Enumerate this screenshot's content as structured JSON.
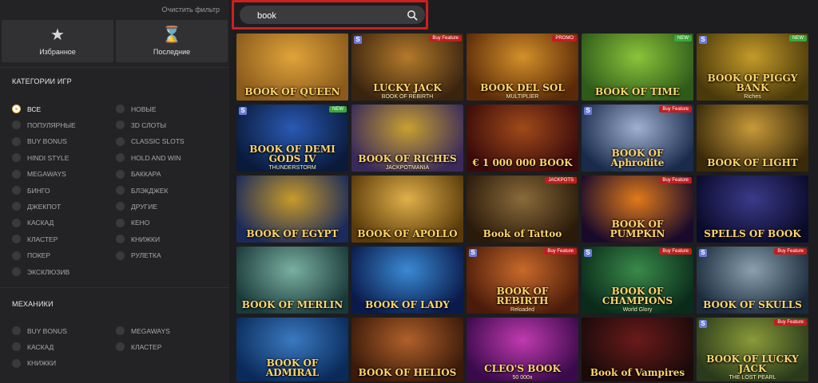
{
  "sidebar": {
    "clear_filter": "Очистить фильтр",
    "favorites_label": "Избранное",
    "recent_label": "Последние",
    "categories_title": "КАТЕГОРИИ ИГР",
    "categories_left": [
      "ВСЕ",
      "ПОПУЛЯРНЫЕ",
      "BUY BONUS",
      "HINDI STYLE",
      "MEGAWAYS",
      "БИНГО",
      "ДЖЕКПОТ",
      "КАСКАД",
      "КЛАСТЕР",
      "ПОКЕР",
      "ЭКСКЛЮЗИВ"
    ],
    "categories_right": [
      "НОВЫЕ",
      "3D СЛОТЫ",
      "CLASSIC SLOTS",
      "HOLD AND WIN",
      "БАККАРА",
      "БЛЭКДЖЕК",
      "ДРУГИЕ",
      "КЕНО",
      "КНИЖКИ",
      "РУЛЕТКА"
    ],
    "mechanics_title": "МЕХАНИКИ",
    "mechanics_left": [
      "BUY BONUS",
      "КАСКАД",
      "КНИЖКИ"
    ],
    "mechanics_right": [
      "MEGAWAYS",
      "КЛАСТЕР"
    ]
  },
  "search": {
    "value": "book"
  },
  "games": [
    {
      "title": "BOOK OF QUEEN",
      "sub": "",
      "bg": "#8a5a1c,#e0a43a",
      "badge": "",
      "prov": false
    },
    {
      "title": "LUCKY JACK",
      "sub": "BOOK OF REBIRTH",
      "bg": "#3a2410,#b47a2a",
      "badge": "Buy Feature",
      "prov": true
    },
    {
      "title": "BOOK DEL SOL",
      "sub": "MULTIPLIER",
      "bg": "#5a2a08,#d4902a",
      "badge": "PROMO",
      "prov": false
    },
    {
      "title": "BOOK OF TIME",
      "sub": "",
      "bg": "#2e5a1a,#8ac43a",
      "badge": "NEW",
      "prov": false
    },
    {
      "title": "BOOK OF PIGGY BANK",
      "sub": "Riches",
      "bg": "#4a3a0a,#c49a2a",
      "badge": "NEW",
      "prov": true
    },
    {
      "title": "BOOK OF DEMI GODS IV",
      "sub": "THUNDERSTORM",
      "bg": "#0a1a3a,#2a5ab4",
      "badge": "NEW",
      "prov": true
    },
    {
      "title": "BOOK OF RICHES",
      "sub": "JACKPOTMANIA",
      "bg": "#3a2a5a,#c8a030",
      "badge": "",
      "prov": false
    },
    {
      "title": "€ 1 000 000 BOOK",
      "sub": "",
      "bg": "#3a0a0a,#a04a1a",
      "badge": "",
      "prov": false
    },
    {
      "title": "BOOK OF Aphrodite",
      "sub": "",
      "bg": "#1a2a4a,#a0b0d0",
      "badge": "Buy Feature",
      "prov": true
    },
    {
      "title": "BOOK OF LIGHT",
      "sub": "",
      "bg": "#3a2a0a,#c89a3a",
      "badge": "",
      "prov": false
    },
    {
      "title": "BOOK OF EGYPT",
      "sub": "",
      "bg": "#1a2a5a,#c89a2a",
      "badge": "",
      "prov": false
    },
    {
      "title": "BOOK OF APOLLO",
      "sub": "",
      "bg": "#5a3a0a,#e0b04a",
      "badge": "",
      "prov": false
    },
    {
      "title": "Book of Tattoo",
      "sub": "",
      "bg": "#2a1a0a,#8a6a3a",
      "badge": "JACKPOTS",
      "prov": false
    },
    {
      "title": "BOOK OF PUMPKIN",
      "sub": "",
      "bg": "#1a0a2a,#e07a1a",
      "badge": "Buy Feature",
      "prov": false
    },
    {
      "title": "SPELLS OF BOOK",
      "sub": "",
      "bg": "#0a0a2a,#3a3a8a",
      "badge": "",
      "prov": false
    },
    {
      "title": "BOOK OF MERLIN",
      "sub": "",
      "bg": "#1a3a3a,#7ab0a0",
      "badge": "",
      "prov": false
    },
    {
      "title": "BOOK OF LADY",
      "sub": "",
      "bg": "#0a1a4a,#3a8ad4",
      "badge": "",
      "prov": false
    },
    {
      "title": "BOOK OF REBIRTH",
      "sub": "Reloaded",
      "bg": "#4a1a0a,#c86a2a",
      "badge": "Buy Feature",
      "prov": true
    },
    {
      "title": "BOOK OF CHAMPIONS",
      "sub": "World Glory",
      "bg": "#0a2a1a,#3a8a4a",
      "badge": "Buy Feature",
      "prov": true
    },
    {
      "title": "BOOK OF SKULLS",
      "sub": "",
      "bg": "#1a2a3a,#8aa0b0",
      "badge": "Buy Feature",
      "prov": true
    },
    {
      "title": "BOOK OF ADMIRAL",
      "sub": "",
      "bg": "#0a2a5a,#3a7ac0",
      "badge": "",
      "prov": false
    },
    {
      "title": "BOOK OF HELIOS",
      "sub": "",
      "bg": "#3a1a0a,#b0602a",
      "badge": "",
      "prov": false
    },
    {
      "title": "CLEO'S BOOK",
      "sub": "50 000x",
      "bg": "#3a0a4a,#c03ab0",
      "badge": "",
      "prov": false
    },
    {
      "title": "Book of Vampires",
      "sub": "",
      "bg": "#1a0a0a,#6a1a1a",
      "badge": "",
      "prov": false
    },
    {
      "title": "BOOK OF LUCKY JACK",
      "sub": "THE LOST PEARL",
      "bg": "#2a3a1a,#8a9a3a",
      "badge": "Buy Feature",
      "prov": true
    }
  ]
}
